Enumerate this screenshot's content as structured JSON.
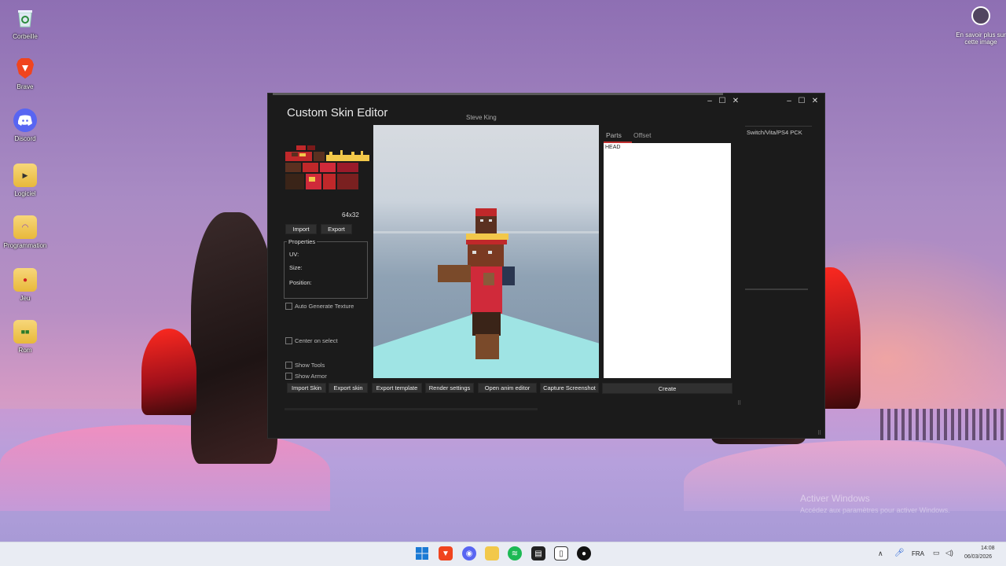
{
  "desktop": {
    "icons": [
      {
        "label": "Corbeille",
        "icon": "recycle-bin-icon"
      },
      {
        "label": "Brave",
        "icon": "brave-icon"
      },
      {
        "label": "Discord",
        "icon": "discord-icon"
      },
      {
        "label": "Logiciel",
        "icon": "folder-icon"
      },
      {
        "label": "Programmation",
        "icon": "folder-icon"
      },
      {
        "label": "Jeu",
        "icon": "folder-icon"
      },
      {
        "label": "Rom",
        "icon": "folder-icon"
      }
    ],
    "info_label": "En savoir plus sur cette image",
    "watermark_title": "Activer Windows",
    "watermark_sub": "Accédez aux paramètres pour activer Windows."
  },
  "app": {
    "title": "Custom Skin Editor",
    "skin_name": "Steve King",
    "texture_size": "64x32",
    "import_label": "Import",
    "export_label": "Export",
    "properties": {
      "legend": "Properties",
      "uv_label": "UV:",
      "size_label": "Size:",
      "position_label": "Position:"
    },
    "auto_generate_label": "Auto Generate Texture",
    "center_on_select_label": "Center on select",
    "show_tools_label": "Show Tools",
    "show_armor_label": "Show Armor",
    "bottom_buttons": {
      "import_skin": "Import Skin",
      "export_skin": "Export skin",
      "export_template": "Export template",
      "render_settings": "Render settings",
      "open_anim_editor": "Open anim editor",
      "capture_screenshot": "Capture Screenshot",
      "create": "Create"
    },
    "tabs": {
      "parts": "Parts",
      "offset": "Offset"
    },
    "parts": [
      "HEAD"
    ],
    "side_panel_title": "Switch/Vita/PS4 PCK",
    "window_controls": {
      "minimize": "–",
      "maximize": "☐",
      "close": "✕"
    }
  },
  "taskbar": {
    "language": "FRA",
    "time": "14:08",
    "date": "06/03/2026",
    "icons": [
      "windows-start-icon",
      "brave-icon",
      "discord-icon",
      "file-explorer-icon",
      "spotify-icon",
      "app-icon",
      "twitch-icon",
      "github-icon"
    ]
  }
}
